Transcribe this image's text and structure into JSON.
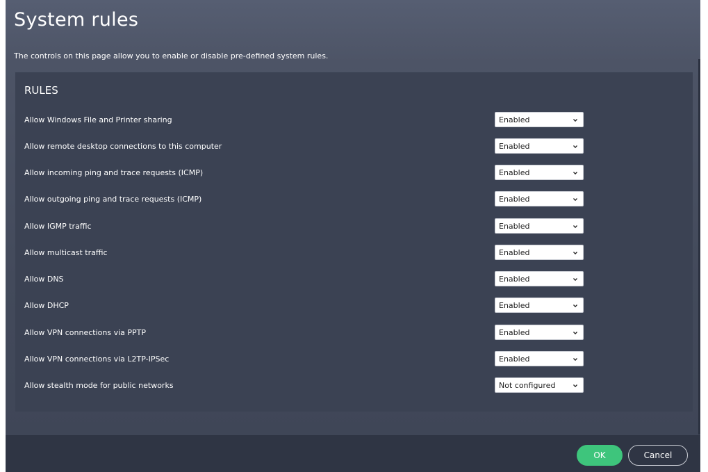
{
  "header": {
    "title": "System rules",
    "description": "The controls on this page allow you to enable or disable pre-defined system rules."
  },
  "panel": {
    "heading": "RULES"
  },
  "rules": [
    {
      "label": "Allow Windows File and Printer sharing",
      "value": "Enabled"
    },
    {
      "label": "Allow remote desktop connections to this computer",
      "value": "Enabled"
    },
    {
      "label": "Allow incoming ping and trace requests (ICMP)",
      "value": "Enabled"
    },
    {
      "label": "Allow outgoing ping and trace requests (ICMP)",
      "value": "Enabled"
    },
    {
      "label": "Allow IGMP traffic",
      "value": "Enabled"
    },
    {
      "label": "Allow multicast traffic",
      "value": "Enabled"
    },
    {
      "label": "Allow DNS",
      "value": "Enabled"
    },
    {
      "label": "Allow DHCP",
      "value": "Enabled"
    },
    {
      "label": "Allow VPN connections via PPTP",
      "value": "Enabled"
    },
    {
      "label": "Allow VPN connections via L2TP-IPSec",
      "value": "Enabled"
    },
    {
      "label": "Allow stealth mode for public networks",
      "value": "Not configured"
    }
  ],
  "footer": {
    "ok_label": "OK",
    "cancel_label": "Cancel"
  },
  "colors": {
    "background": "#4d5466",
    "panel": "#3b4253",
    "footer": "#2f3544",
    "ok_button": "#3ec57c"
  },
  "icons": {
    "dropdown": "chevron-down-icon"
  }
}
